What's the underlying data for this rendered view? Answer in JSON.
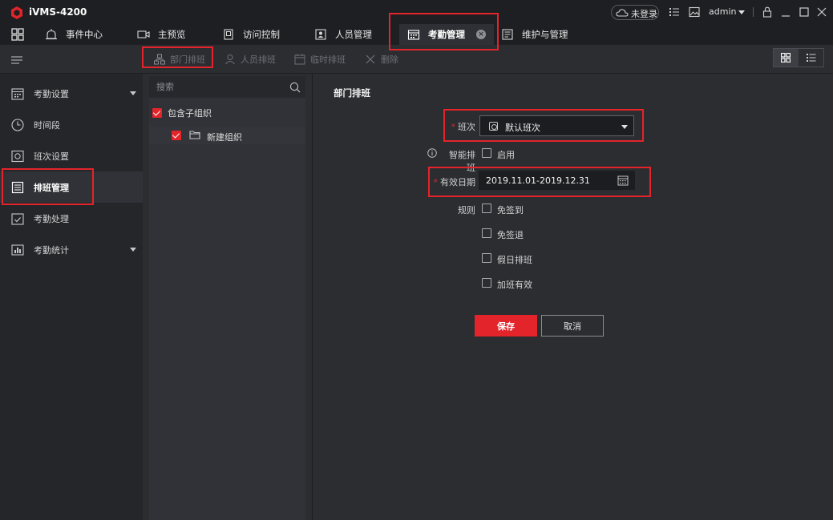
{
  "app": {
    "name": "iVMS-4200",
    "accent": "#e3242b"
  },
  "titlebar": {
    "login_status": "未登录",
    "user": "admin",
    "icons": [
      "cloud-icon",
      "list-icon",
      "image-icon",
      "lock-icon",
      "minimize-icon",
      "maximize-icon",
      "close-icon"
    ]
  },
  "tabs": [
    {
      "label": "事件中心"
    },
    {
      "label": "主预览"
    },
    {
      "label": "访问控制"
    },
    {
      "label": "人员管理"
    },
    {
      "label": "考勤管理",
      "active": true
    },
    {
      "label": "维护与管理"
    }
  ],
  "toolbar": {
    "dept_schedule": "部门排班",
    "person_schedule": "人员排班",
    "temp_schedule": "临时排班",
    "delete": "删除"
  },
  "sidebar": {
    "items": [
      {
        "label": "考勤设置",
        "expandable": true
      },
      {
        "label": "时间段"
      },
      {
        "label": "班次设置"
      },
      {
        "label": "排班管理",
        "active": true
      },
      {
        "label": "考勤处理"
      },
      {
        "label": "考勤统计",
        "expandable": true
      }
    ]
  },
  "tree": {
    "search_placeholder": "搜索",
    "include_sub": "包含子组织",
    "nodes": [
      {
        "label": "新建组织",
        "checked": true
      }
    ]
  },
  "form": {
    "section_title": "部门排班",
    "shift_label": "班次",
    "shift_value": "默认班次",
    "smart_label": "智能排班",
    "smart_option": "启用",
    "date_label": "有效日期",
    "date_value": "2019.11.01-2019.12.31",
    "rules_label": "规则",
    "rules": [
      "免签到",
      "免签退",
      "假日排班",
      "加班有效"
    ],
    "save": "保存",
    "cancel": "取消"
  }
}
